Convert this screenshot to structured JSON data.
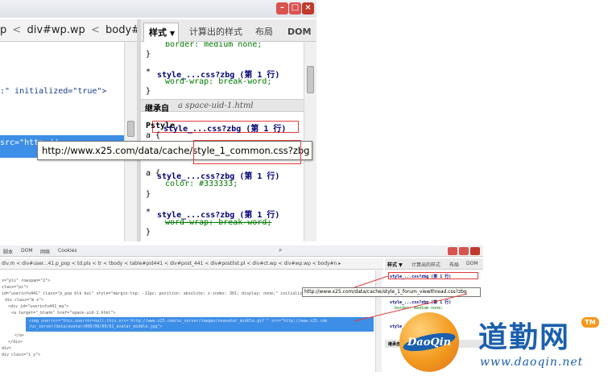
{
  "top": {
    "breadcrumb": [
      "p",
      "div#wp.wp",
      "body#n"
    ],
    "separator": "<",
    "crumb_more": "▸",
    "code_line_initialized": ":\" initialized=\"true\">",
    "code_line_src": "src=\"http://",
    "tabs": [
      "样式",
      "计算出的样式",
      "布局",
      "DOM"
    ],
    "tab_dropdown": "▼",
    "rules": {
      "line0": "border: medium none;",
      "brace_close": "}",
      "star": "*",
      "sel_wrap": "style_...css?zbg (第 1 行)",
      "wordwrap": "word-wrap: break-word;",
      "inherit_label": "继承自",
      "inherit_source": "a  space-uid-1.html",
      "p_partial": "Pstyle",
      "p_sel": "style_...css?zbg (第 1 行)",
      "a_open": "a {",
      "a_sel": "style_...css?zbg (第 1 行)",
      "color_line": "color: #333333;",
      "wordwrap_struck": "word-wrap: break-word;"
    },
    "tooltip": "http://www.x25.com/data/cache/style_1_common.css?zbg"
  },
  "bottom": {
    "menu": [
      "脚本",
      "DOM",
      "网络",
      "Cookies"
    ],
    "breadcrumb": "div.m < div#user...41.p_pop < td.pls < tr < tbody < table#pid441 < div#post_441 < div#postlist.pl < div#ct.wp < div#wp.wp < body#n ▸",
    "tabs": [
      "样式 ▼",
      "计算出的样式",
      "布局",
      "DOM"
    ],
    "code_lines": [
      "s=\"pls\" rowspan=\"2\">",
      "class=\"pi\">",
      "id=\"userinfo441\" class=\"p_pop blk bui\" style=\"margin-top: -11px; position: absolute; z-index: 301; display: none;\" initialized=\"true\">",
      "div class=\"m z\">",
      "<div id=\"userinfo441_ma\">",
      "<a target=\"_blank\" href=\"space-uid-1.html\">",
      "<img onerror=\"this.onerror=null;this.src='http://www.x25.com/uc_server/images/noavatar_middle.gif'\" src=\"http://www.x25.com",
      "/uc_server/data/avatar/000/00/00/01_avatar_middle.jpg\">",
      "</a>",
      "</div>",
      "div>",
      "div class=\"i y\">"
    ],
    "tooltip": "http://www.x25.com/data/cache/style_1_forum_viewthread.css?zbg",
    "rule1": "style_...css?zbg (第 1 行)",
    "rule1_prop": "border: medium none;",
    "inherit_label": "继承自"
  },
  "logo": {
    "badge": "DaoQin",
    "chinese": "道勤网",
    "tm": "TM",
    "url": "www.daoqin.net"
  },
  "colors": {
    "close": "#d9534f",
    "selection": "#3d8ee6",
    "highlight_box": "#e23b3b",
    "logo_orange": "#f39a1f",
    "logo_blue": "#1b5fad"
  }
}
